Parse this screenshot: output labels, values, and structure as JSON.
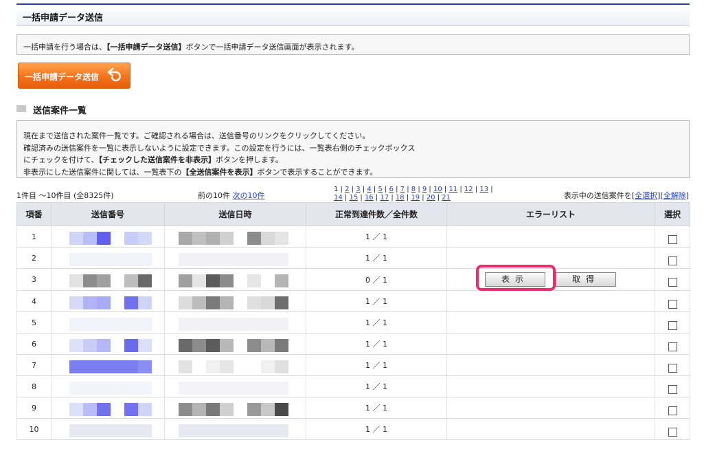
{
  "page": {
    "title": "一括申請データ送信",
    "notice_pre": "一括申請を行う場合は、",
    "notice_bold": "【一括申請データ送信】",
    "notice_post": "ボタンで一括申請データ送信画面が表示されます。",
    "bulk_button_label": "一括申請データ送信"
  },
  "section": {
    "heading": "送信案件一覧",
    "desc1": "現在まで送信された案件一覧です。ご確認される場合は、送信番号のリンクをクリックしてください。",
    "desc2": "確認済みの送信案件を一覧に表示しないように設定できます。この設定を行うには、一覧表右側のチェックボックス",
    "desc3_pre": "にチェックを付けて、",
    "desc3_bold": "【チェックした送信案件を非表示】",
    "desc3_post": "ボタンを押します。",
    "desc4_pre": "非表示にした送信案件に関しては、一覧表下の",
    "desc4_bold": "【全送信案件を表示】",
    "desc4_post": "ボタンで表示することができます。"
  },
  "pagination": {
    "range": "1件目 ～10件目 (全8325件)",
    "prev_label": "前の10件",
    "next_label": "次の10件",
    "pages_row1": [
      "1",
      "2",
      "3",
      "4",
      "5",
      "6",
      "7",
      "8",
      "9",
      "10",
      "11",
      "12",
      "13"
    ],
    "pages_row2": [
      "14",
      "15",
      "16",
      "17",
      "18",
      "19",
      "20",
      "21"
    ],
    "select_prefix": "表示中の送信案件を[",
    "select_all": "全選択",
    "select_mid": "][",
    "deselect_all": "全解除",
    "select_suffix": "]"
  },
  "table": {
    "headers": [
      "項番",
      "送信番号",
      "送信日時",
      "正常到達件数／全件数",
      "エラーリスト",
      "選択"
    ],
    "rows": [
      {
        "no": "1",
        "count": "1 ／ 1"
      },
      {
        "no": "2",
        "count": "1 ／ 1"
      },
      {
        "no": "3",
        "count": "0 ／ 1"
      },
      {
        "no": "4",
        "count": "1 ／ 1"
      },
      {
        "no": "5",
        "count": "1 ／ 1"
      },
      {
        "no": "6",
        "count": "1 ／ 1"
      },
      {
        "no": "7",
        "count": "1 ／ 1"
      },
      {
        "no": "8",
        "count": "1 ／ 1"
      },
      {
        "no": "9",
        "count": "1 ／ 1"
      },
      {
        "no": "10",
        "count": "1 ／ 1"
      }
    ],
    "error_row_index": 2,
    "show_button": "表示",
    "fetch_button": "取得"
  },
  "colors": {
    "highlight": "#ee2d6f",
    "orange_button": "#f4711b",
    "link": "#1a3fd6",
    "header_bg": "#e4e6ed"
  }
}
